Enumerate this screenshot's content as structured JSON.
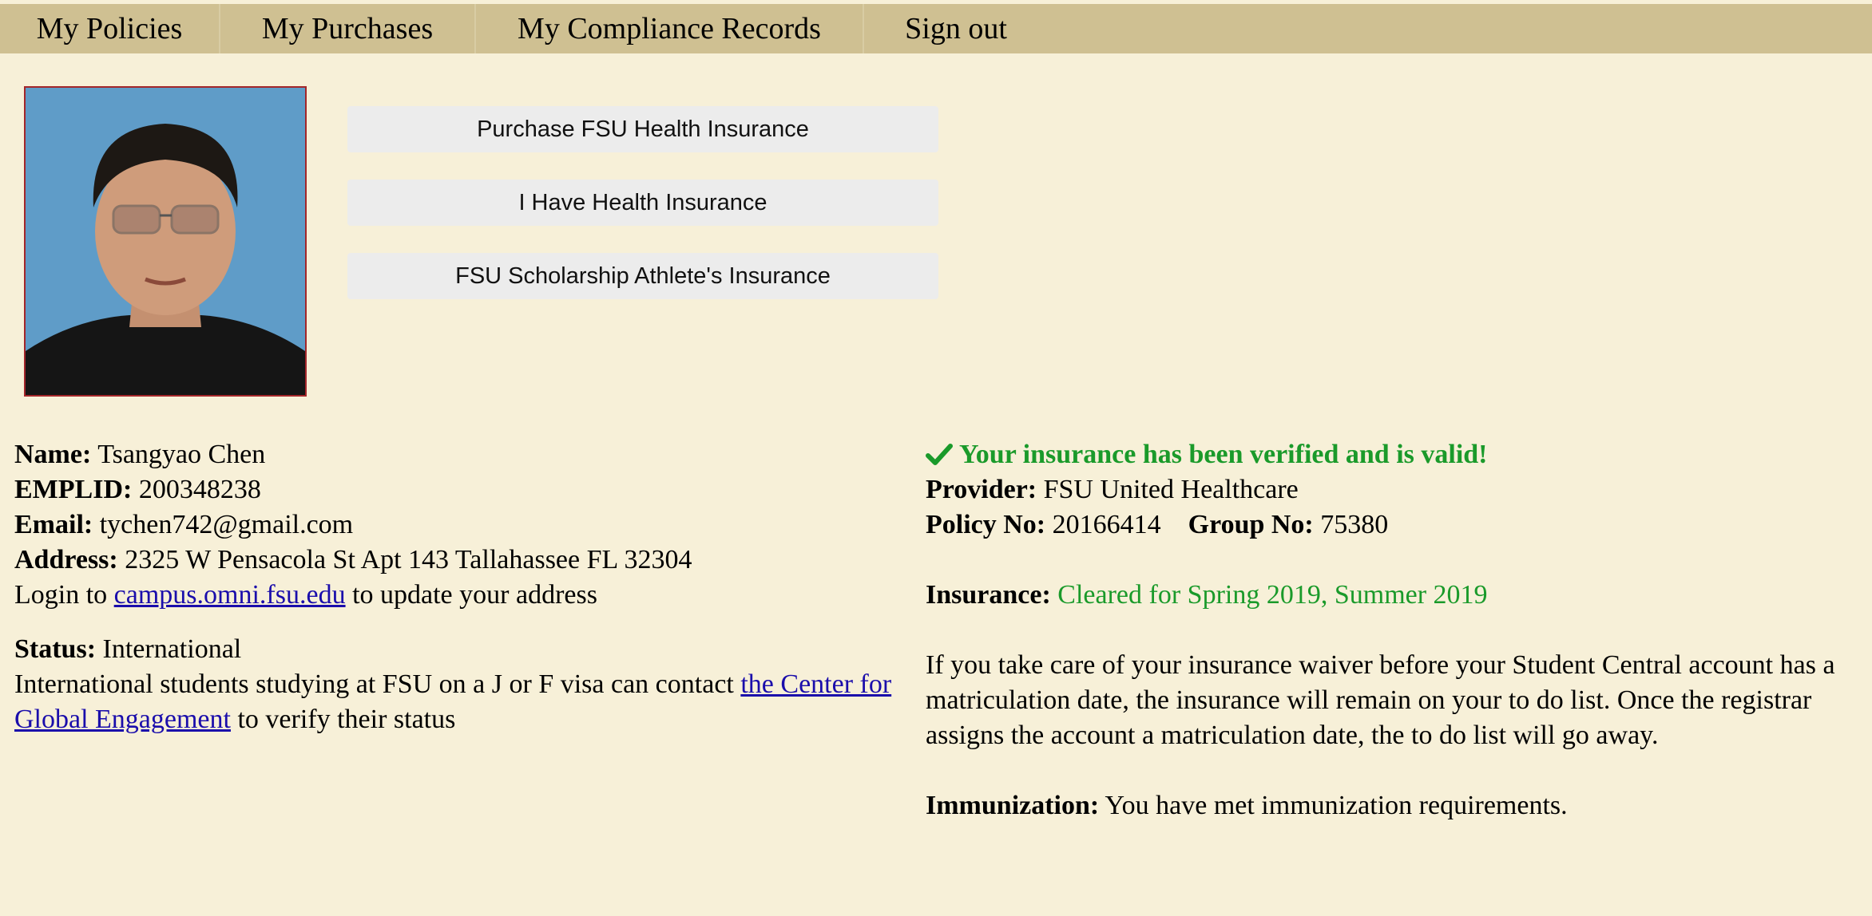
{
  "nav": {
    "items": [
      "My Policies",
      "My Purchases",
      "My Compliance Records",
      "Sign out"
    ]
  },
  "photo": {
    "alt": "Student photo"
  },
  "actions": {
    "purchase": "Purchase FSU Health Insurance",
    "have": "I Have Health Insurance",
    "athlete": "FSU Scholarship Athlete's Insurance"
  },
  "student": {
    "name_label": "Name:",
    "name": "Tsangyao Chen",
    "emplid_label": "EMPLID:",
    "emplid": "200348238",
    "email_label": "Email:",
    "email": "tychen742@gmail.com",
    "address_label": "Address:",
    "address": "2325 W Pensacola St Apt 143 Tallahassee FL 32304",
    "login_prefix": "Login to",
    "login_link": "campus.omni.fsu.edu",
    "login_suffix": "to update your address",
    "status_label": "Status:",
    "status": "International",
    "status_note_prefix": "International students studying at FSU on a J or F visa can contact",
    "status_note_link": "the Center for Global Engagement",
    "status_note_suffix": "to verify their status"
  },
  "insurance": {
    "verified": "Your insurance has been verified and is valid!",
    "provider_label": "Provider:",
    "provider": "FSU United Healthcare",
    "policy_label": "Policy No:",
    "policy": "20166414",
    "group_label": "Group No:",
    "group": "75380",
    "insurance_label": "Insurance:",
    "cleared": "Cleared for Spring 2019, Summer 2019",
    "note": "If you take care of your insurance waiver before your Student Central account has a matriculation date, the insurance will remain on your to do list. Once the registrar assigns the account a matriculation date, the to do list will go away.",
    "immunization_label": "Immunization:",
    "immunization": "You have met immunization requirements."
  },
  "colors": {
    "nav_bg": "#cfc092",
    "page_bg": "#f7f0d8",
    "success": "#1a9a2a",
    "link": "#1a0dab"
  },
  "icons": {
    "verified": "checkmark-icon"
  }
}
